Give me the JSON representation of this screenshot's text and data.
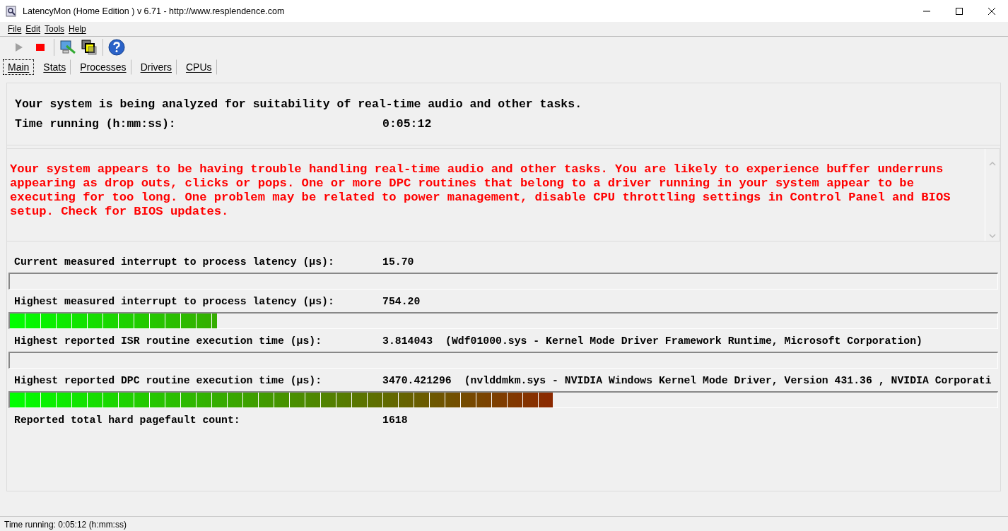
{
  "window": {
    "title": "LatencyMon  (Home Edition )  v 6.71 - http://www.resplendence.com"
  },
  "menu": [
    "File",
    "Edit",
    "Tools",
    "Help"
  ],
  "tabs": [
    {
      "label": "Main",
      "selected": true
    },
    {
      "label": "Stats",
      "selected": false
    },
    {
      "label": "Processes",
      "selected": false
    },
    {
      "label": "Drivers",
      "selected": false
    },
    {
      "label": "CPUs",
      "selected": false
    }
  ],
  "header": {
    "heading": "Your system is being analyzed for suitability of real-time audio and other tasks.",
    "time_label": "Time running (h:mm:ss):",
    "time_value": "0:05:12"
  },
  "verdict": "Your system appears to be having trouble handling real-time audio and other tasks. You are likely to experience buffer underruns appearing as drop outs, clicks or pops. One or more DPC routines that belong to a driver running in your system appear to be executing for too long. One problem may be related to power management, disable CPU throttling settings in Control Panel and BIOS setup. Check for BIOS updates.",
  "metrics": [
    {
      "label": "Current measured interrupt to process latency (µs):",
      "value": "15.70",
      "level": 0
    },
    {
      "label": "Highest measured interrupt to process latency (µs):",
      "value": "754.20",
      "level": 0.21
    },
    {
      "label": "Highest reported ISR routine execution time (µs):",
      "value": "3.814043",
      "detail": "(Wdf01000.sys - Kernel Mode Driver Framework Runtime, Microsoft Corporation)",
      "level": 0
    },
    {
      "label": "Highest reported DPC routine execution time (µs):",
      "value": "3470.421296",
      "detail": "(nvlddmkm.sys - NVIDIA Windows Kernel Mode Driver, Version 431.36 , NVIDIA Corporati",
      "level": 0.55
    }
  ],
  "pagefault": {
    "label": "Reported total hard pagefault count:",
    "value": "1618"
  },
  "status_bar": "Time running: 0:05:12  (h:mm:ss)"
}
